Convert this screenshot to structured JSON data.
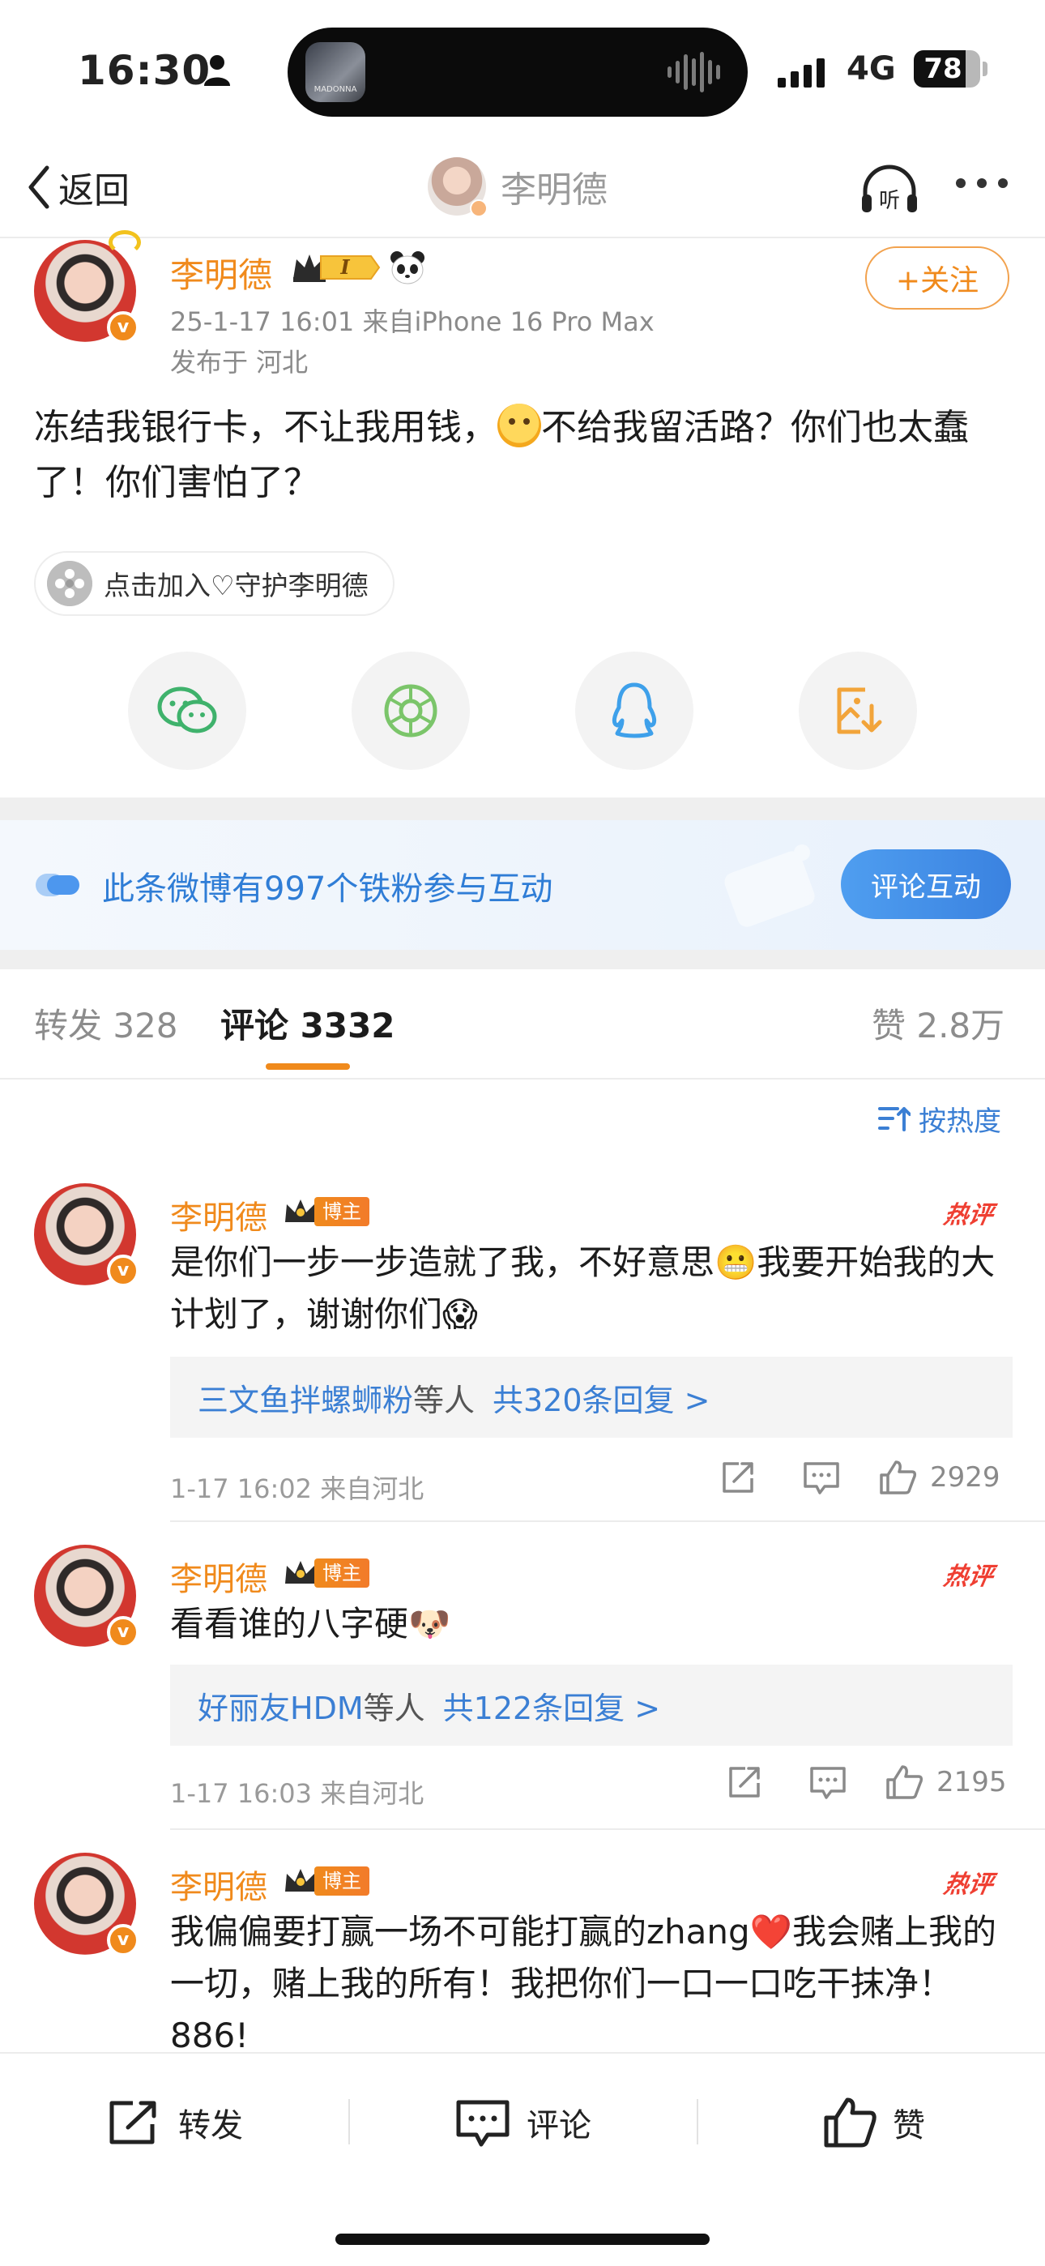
{
  "status_bar": {
    "time": "16:30",
    "network": "4G",
    "battery": "78",
    "battery_level": 0.78,
    "now_playing_art_text": "MADONNA"
  },
  "nav": {
    "back_label": "返回",
    "title": "李明德",
    "listen_label": "听"
  },
  "post": {
    "author": "李明德",
    "level_badge": "I",
    "meta": "25-1-17 16:01  来自iPhone 16 Pro Max",
    "location": "发布于 河北",
    "follow_label": "+关注",
    "text_part1": "冻结我银行卡，不让我用钱，",
    "text_part2": "不给我留活路？你们也太蠢了！你们害怕了？",
    "guard_label": "点击加入♡守护李明德"
  },
  "share_targets": [
    "wechat-icon",
    "moments-icon",
    "qq-icon",
    "save-image-icon"
  ],
  "fans_banner": {
    "text": "此条微博有997个铁粉参与互动",
    "button": "评论互动"
  },
  "tabs": {
    "repost": "转发 328",
    "comments": "评论 3332",
    "likes": "赞 2.8万"
  },
  "sort_label": "按热度",
  "comments": [
    {
      "name": "李明德",
      "host_badge": "博主",
      "hot_label": "热评",
      "text": "是你们一步一步造就了我，不好意思😬我要开始我的大计划了，谢谢你们😱",
      "reply_name": "三文鱼拌螺蛳粉",
      "reply_etc": "等人",
      "reply_count": "共320条回复 >",
      "meta": "1-17 16:02  来自河北",
      "likes": "2929"
    },
    {
      "name": "李明德",
      "host_badge": "博主",
      "hot_label": "热评",
      "text": "看看谁的八字硬🐶",
      "reply_name": "好丽友HDM",
      "reply_etc": "等人",
      "reply_count": "共122条回复 >",
      "meta": "1-17 16:03  来自河北",
      "likes": "2195"
    },
    {
      "name": "李明德",
      "host_badge": "博主",
      "hot_label": "热评",
      "text": "我偏偏要打赢一场不可能打赢的zhang❤️我会赌上我的一切，赌上我的所有！我把你们一口一口吃干抹净！886!"
    }
  ],
  "bottom_bar": {
    "repost": "转发",
    "comment": "评论",
    "like": "赞"
  },
  "colors": {
    "accent_orange": "#f08a1c",
    "link_blue": "#3b7fd4",
    "hot_red": "#ef3f32"
  }
}
